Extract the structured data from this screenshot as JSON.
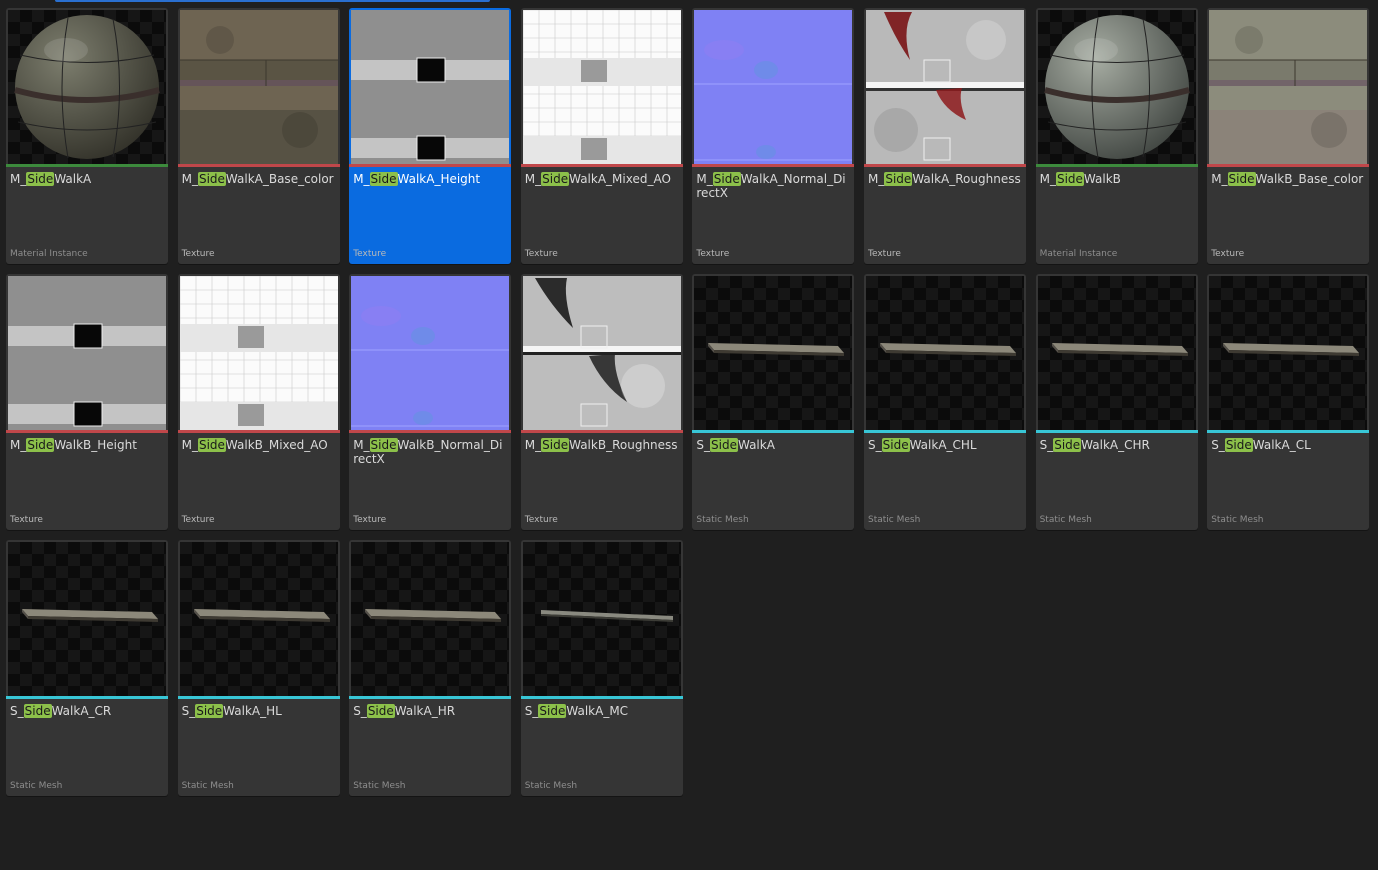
{
  "search_highlight": "Side",
  "type_colors": {
    "Material Instance": "#3c8a3c",
    "Texture": "#c0474a",
    "Static Mesh": "#38c6d6"
  },
  "selection_color": "#0a6be0",
  "assets": [
    {
      "name": "M_SideWalkA",
      "type": "Material Instance",
      "thumb": "sphere-dark-icon",
      "selected": false
    },
    {
      "name": "M_SideWalkA_Base_color",
      "type": "Texture",
      "thumb": "base-color-texture-icon",
      "selected": false
    },
    {
      "name": "M_SideWalkA_Height",
      "type": "Texture",
      "thumb": "height-texture-icon",
      "selected": true
    },
    {
      "name": "M_SideWalkA_Mixed_AO",
      "type": "Texture",
      "thumb": "ao-texture-icon",
      "selected": false
    },
    {
      "name": "M_SideWalkA_Normal_DirectX",
      "type": "Texture",
      "thumb": "normal-texture-icon",
      "selected": false
    },
    {
      "name": "M_SideWalkA_Roughness",
      "type": "Texture",
      "thumb": "roughness-red-texture-icon",
      "selected": false
    },
    {
      "name": "M_SideWalkB",
      "type": "Material Instance",
      "thumb": "sphere-light-icon",
      "selected": false
    },
    {
      "name": "M_SideWalkB_Base_color",
      "type": "Texture",
      "thumb": "base-color-b-texture-icon",
      "selected": false
    },
    {
      "name": "M_SideWalkB_Height",
      "type": "Texture",
      "thumb": "height-texture-icon",
      "selected": false
    },
    {
      "name": "M_SideWalkB_Mixed_AO",
      "type": "Texture",
      "thumb": "ao-texture-icon",
      "selected": false
    },
    {
      "name": "M_SideWalkB_Normal_DirectX",
      "type": "Texture",
      "thumb": "normal-texture-icon",
      "selected": false
    },
    {
      "name": "M_SideWalkB_Roughness",
      "type": "Texture",
      "thumb": "roughness-dark-texture-icon",
      "selected": false
    },
    {
      "name": "S_SideWalkA",
      "type": "Static Mesh",
      "thumb": "mesh-slab-icon",
      "selected": false
    },
    {
      "name": "S_SideWalkA_CHL",
      "type": "Static Mesh",
      "thumb": "mesh-slab-icon",
      "selected": false
    },
    {
      "name": "S_SideWalkA_CHR",
      "type": "Static Mesh",
      "thumb": "mesh-slab-icon",
      "selected": false
    },
    {
      "name": "S_SideWalkA_CL",
      "type": "Static Mesh",
      "thumb": "mesh-slab-icon",
      "selected": false
    },
    {
      "name": "S_SideWalkA_CR",
      "type": "Static Mesh",
      "thumb": "mesh-slab-icon",
      "selected": false
    },
    {
      "name": "S_SideWalkA_HL",
      "type": "Static Mesh",
      "thumb": "mesh-slab-icon",
      "selected": false
    },
    {
      "name": "S_SideWalkA_HR",
      "type": "Static Mesh",
      "thumb": "mesh-slab-icon",
      "selected": false
    },
    {
      "name": "S_SideWalkA_MC",
      "type": "Static Mesh",
      "thumb": "mesh-thin-icon",
      "selected": false
    }
  ]
}
